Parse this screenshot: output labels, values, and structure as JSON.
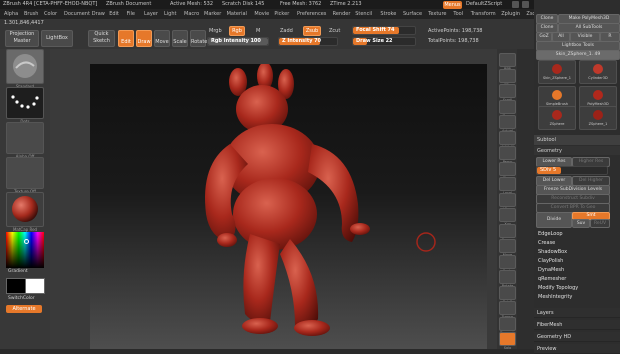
{
  "title_bar": {
    "app": "ZBrush 4R4",
    "build": "[CETA-PHFF-EHOD-NBQT]",
    "document": "ZBrush Document",
    "active_mesh": "Active Mesh: 532",
    "scratch_disk": "Scratch Disk 145",
    "free_mesh": "Free Mesh: 3762",
    "zt_time": "ZTime 2.213",
    "menus_button": "Menus",
    "script_label": "DefaultZScript"
  },
  "menu_bar": [
    "Alpha",
    "Brush",
    "Color",
    "Document",
    "Draw",
    "Edit",
    "File",
    "Layer",
    "Light",
    "Macro",
    "Marker",
    "Material",
    "Movie",
    "Picker",
    "Preferences",
    "Render",
    "Stencil",
    "Stroke",
    "Surface",
    "Texture",
    "Tool",
    "Transform",
    "Zplugin",
    "Zscript"
  ],
  "shelf": {
    "coords": "1.301,846,4417",
    "projection_master": "Projection Master",
    "lightbox": "LightBox",
    "quick_sketch": "Quick Sketch",
    "edit": "Edit",
    "draw": "Draw",
    "move": "Move",
    "scale": "Scale",
    "rotate": "Rotate",
    "mrgb": "Mrgb",
    "rgb": "Rgb",
    "m": "M",
    "rgb_intensity_label": "Rgb Intensity",
    "rgb_intensity_value": "100",
    "zadd": "Zadd",
    "zsub": "Zsub",
    "zcut": "Zcut",
    "z_intensity_label": "Z Intensity",
    "z_intensity_value": "70",
    "focal_shift_label": "Focal Shift",
    "focal_shift_value": "74",
    "draw_size_label": "Draw Size",
    "draw_size_value": "22",
    "active_points": "ActivePoints: 198,738",
    "total_points": "TotalPoints: 198,738",
    "z_intensity_fraction": 0.7,
    "focal_shift_fraction": 0.74,
    "draw_size_fraction": 0.22,
    "rgb_intensity_fraction": 1.0
  },
  "left_shelf": {
    "brush_caption": "Standard",
    "stroke_caption": "Dots",
    "alpha_caption": "Alpha Off",
    "texture_caption": "Texture Off",
    "material_caption": "MatCap Red",
    "gradient_label": "Gradient",
    "switch_color_label": "SwitchColor",
    "alternate_label": "Alternate"
  },
  "right_tools": [
    "BPR",
    "SPix",
    "Scroll",
    "Zoom",
    "Actual",
    "AAHalf",
    "Persp",
    "Floor",
    "Local",
    "LSym",
    "Xyz",
    "Frame",
    "Move",
    "Scale",
    "Rotate",
    "PolyF",
    "Transp",
    "Dynamic",
    "Solo"
  ],
  "tool_panel": {
    "buttons_row1": [
      "Clone",
      "Make PolyMesh3D"
    ],
    "buttons_row2": [
      "Clone",
      "All SubTools"
    ],
    "buttons_row3": [
      "GoZ",
      "All",
      "Visible",
      "R"
    ],
    "lightbox_tools": "Lightbox Tools",
    "current_tool": "Skin_ZSphere_1. 49",
    "thumbs": [
      "Skin_ZSphere_1",
      "Cylinder3D",
      "SimpleBrush",
      "PolyMesh3D",
      "ZSphere",
      "Skin_ZSphere_1",
      "ZSphere_1"
    ],
    "subtool": "Subtool",
    "geometry": "Geometry",
    "lower_res": "Lower Res",
    "higher_res": "Higher Res",
    "sdiv": "SDiv 5",
    "del_lower": "Del Lower",
    "del_higher": "Del Higher",
    "freeze_subdivision": "Freeze SubDivision Levels",
    "reconstruct_subdiv": "Reconstruct Subdiv",
    "convert_bpr": "Convert BPR To Geo",
    "divide": "Divide",
    "smt": "Smt",
    "suv": "Suv",
    "reuv": "ReUV",
    "sections": [
      "EdgeLoop",
      "Crease",
      "ShadowBox",
      "ClayPolish",
      "DynaMesh",
      "qRemesher",
      "Modify Topology",
      "MeshIntegrity"
    ],
    "lower_sections": [
      "Layers",
      "FiberMesh",
      "Geometry HD",
      "Preview"
    ]
  },
  "colors": {
    "accent": "#e6782a",
    "model": "#a8281c",
    "panel_bg": "#2d2d2d"
  }
}
